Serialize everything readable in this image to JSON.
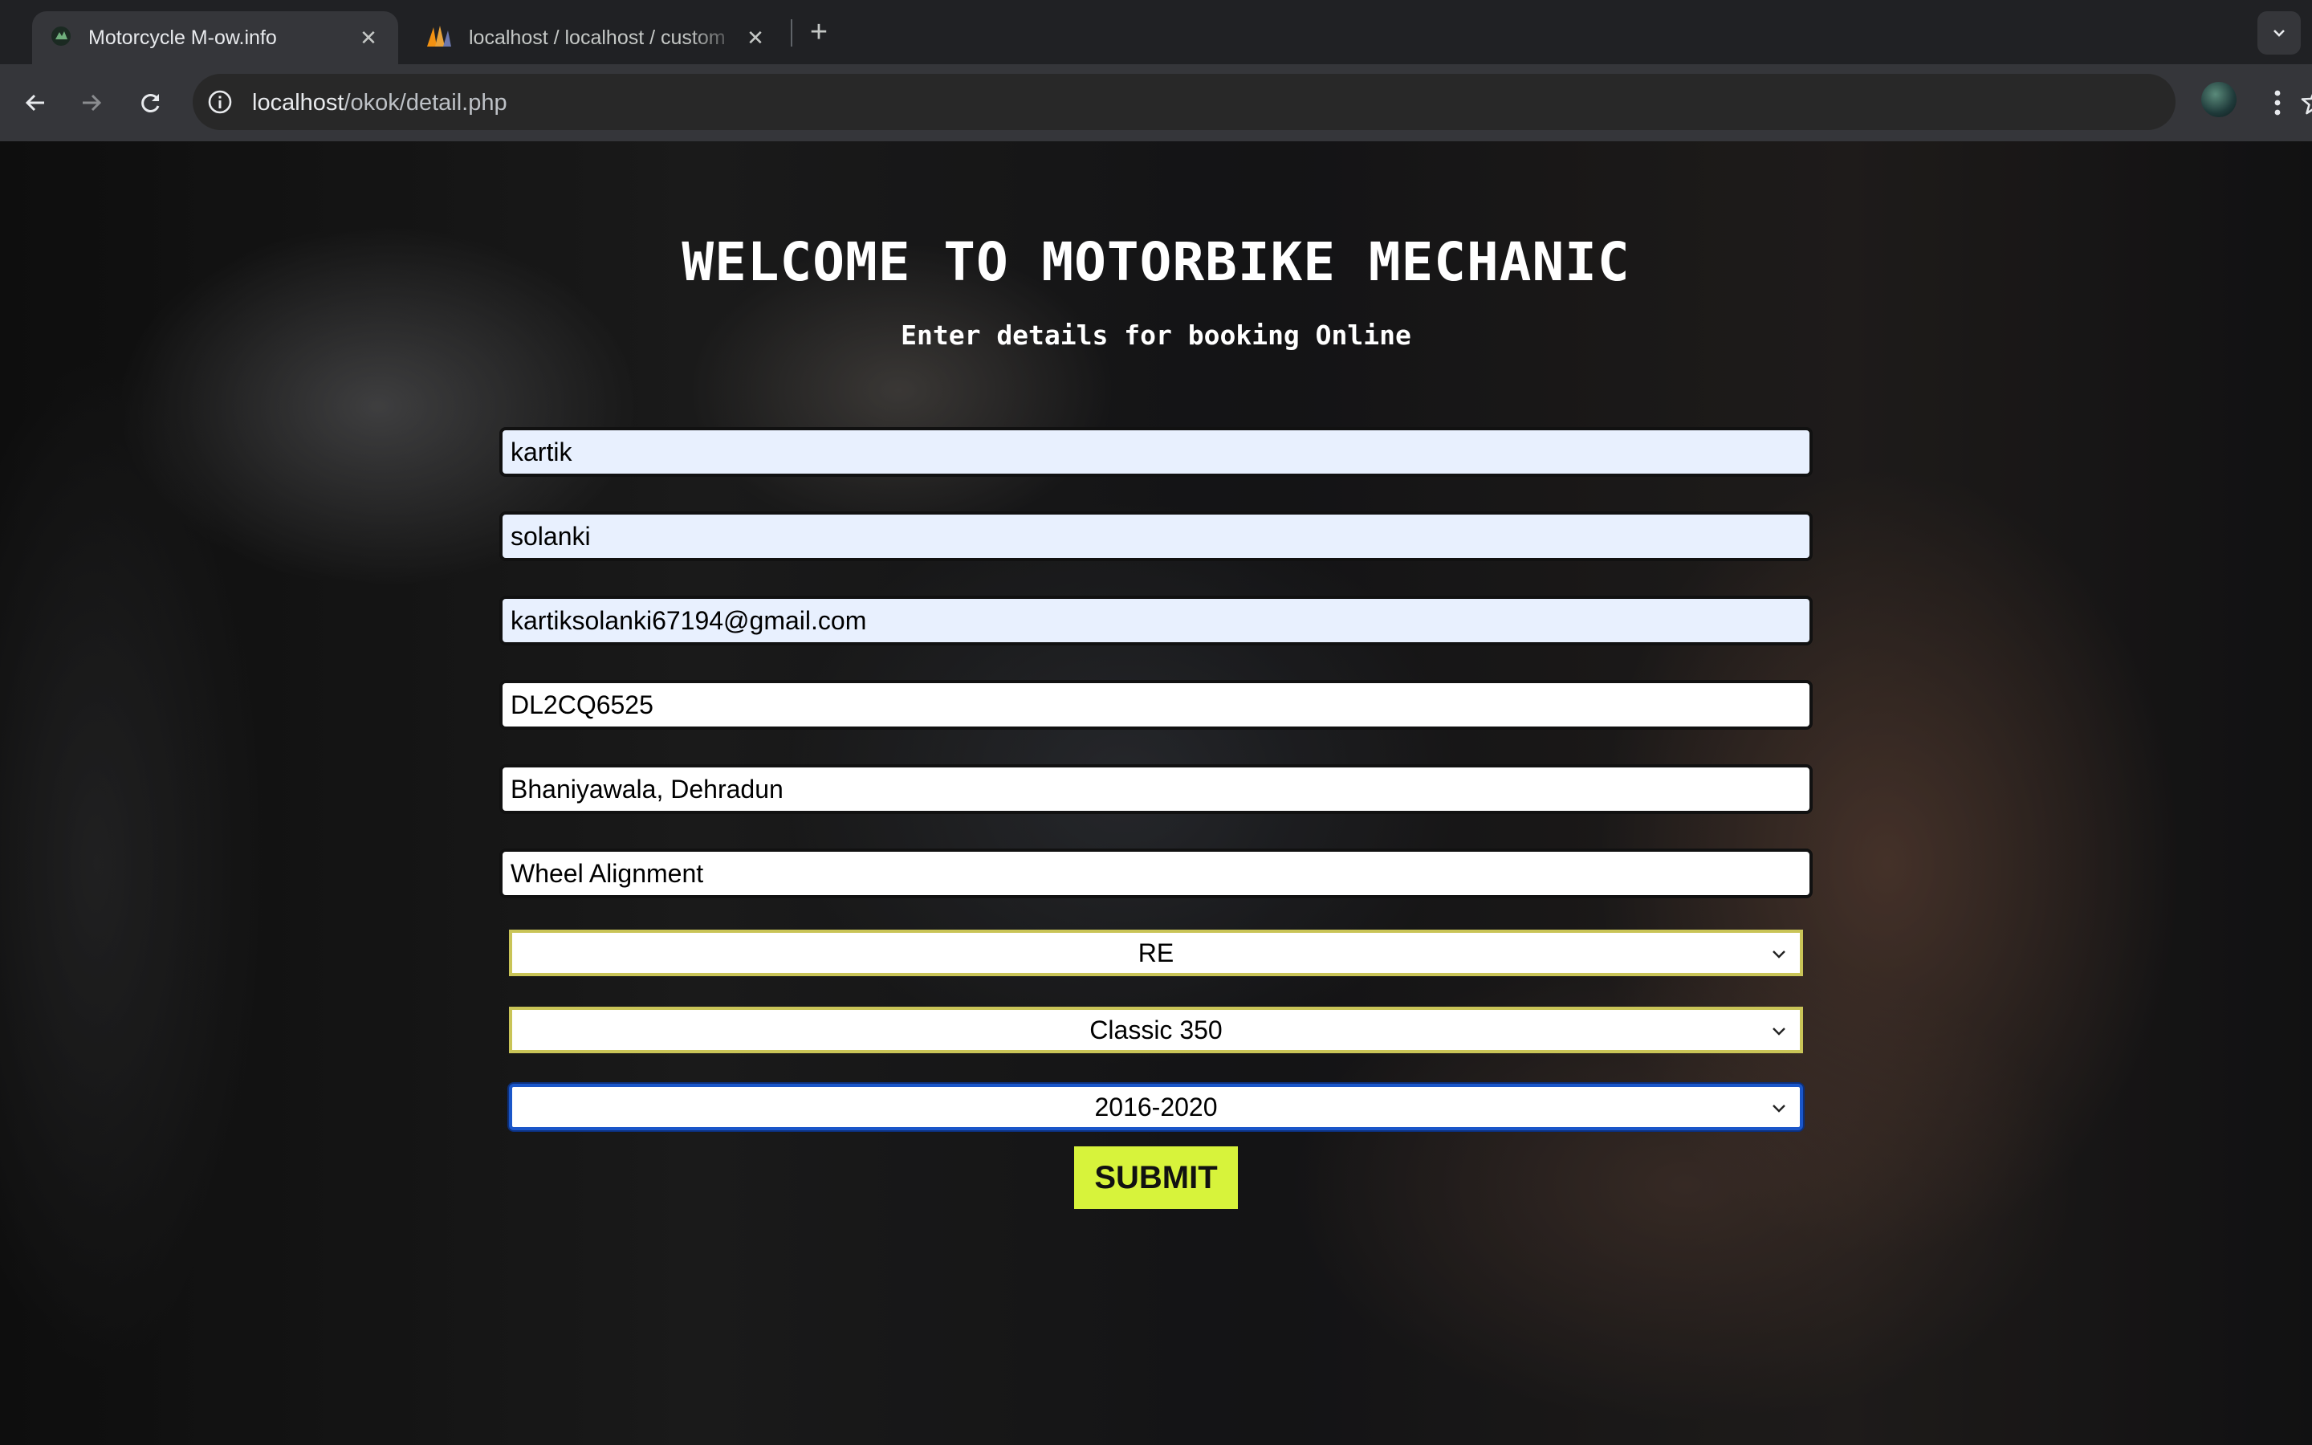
{
  "browser": {
    "tabs": [
      {
        "title": "Motorcycle M-ow.info",
        "active": true
      },
      {
        "title": "localhost / localhost / custom",
        "active": false
      }
    ],
    "url_host": "localhost",
    "url_path": "/okok/detail.php"
  },
  "page": {
    "heading": "WELCOME TO MOTORBIKE MECHANIC",
    "subheading": "Enter details for booking Online",
    "fields": {
      "first_name": "kartik",
      "last_name": "solanki",
      "email": "kartiksolanki67194@gmail.com",
      "vehicle_number": "DL2CQ6525",
      "address": "Bhaniyawala, Dehradun",
      "service": "Wheel Alignment"
    },
    "selects": {
      "brand": "RE",
      "model": "Classic 350",
      "year": "2016-2020"
    },
    "submit_label": "SUBMIT"
  },
  "colors": {
    "submit_bg": "#d7f33b",
    "autofill_bg": "#e8f0fe",
    "select_border": "#c9c457",
    "focus_border": "#1a56c9"
  }
}
